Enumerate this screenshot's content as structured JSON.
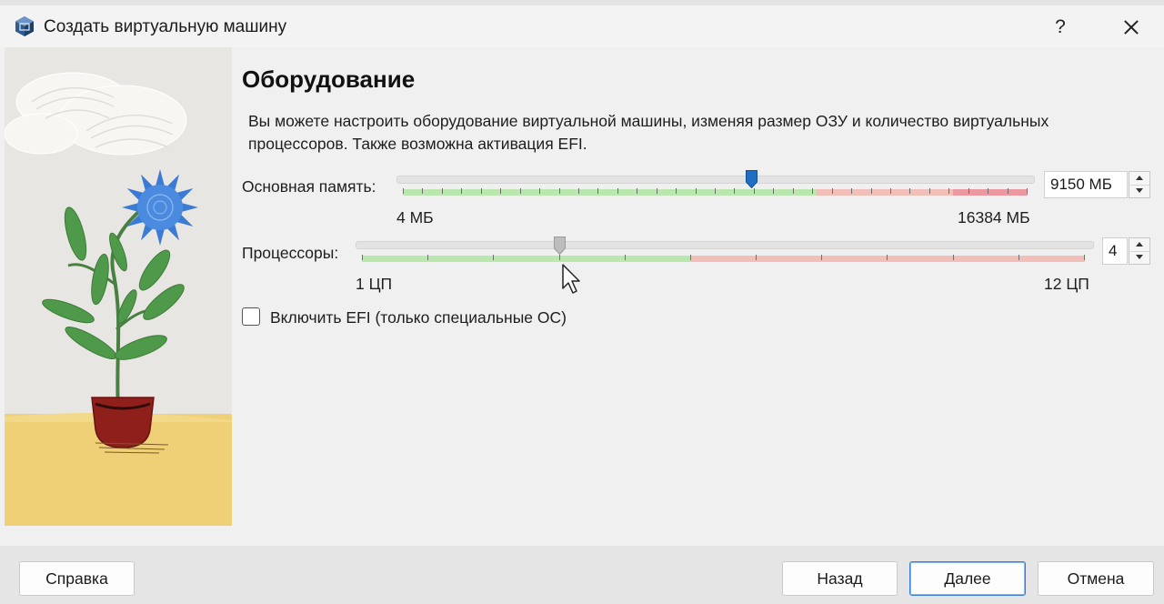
{
  "window": {
    "title": "Создать виртуальную машину",
    "help_label": "?"
  },
  "page": {
    "title": "Оборудование",
    "description": "Вы можете настроить оборудование виртуальной машины, изменяя размер ОЗУ и количество виртуальных процессоров. Также возможна активация EFI."
  },
  "memory": {
    "label": "Основная память:",
    "value": "9150 МБ",
    "min_label": "4 МБ",
    "max_label": "16384 МБ",
    "value_mb": 9150,
    "min_mb": 4,
    "max_mb": 16384,
    "accent_color": "#1f6fc4"
  },
  "cpu": {
    "label": "Процессоры:",
    "value": "4",
    "min_label": "1 ЦП",
    "max_label": "12 ЦП",
    "count": 4,
    "min": 1,
    "max": 12
  },
  "efi": {
    "label": "Включить EFI (только специальные ОС)",
    "checked": false
  },
  "buttons": {
    "help": "Справка",
    "back": "Назад",
    "next": "Далее",
    "cancel": "Отмена"
  },
  "colors": {
    "safe_band": "#b9e7ad",
    "warn_band": "#f1bfb7",
    "danger_band": "#ec98a0",
    "primary_border": "#3b7fd2"
  }
}
